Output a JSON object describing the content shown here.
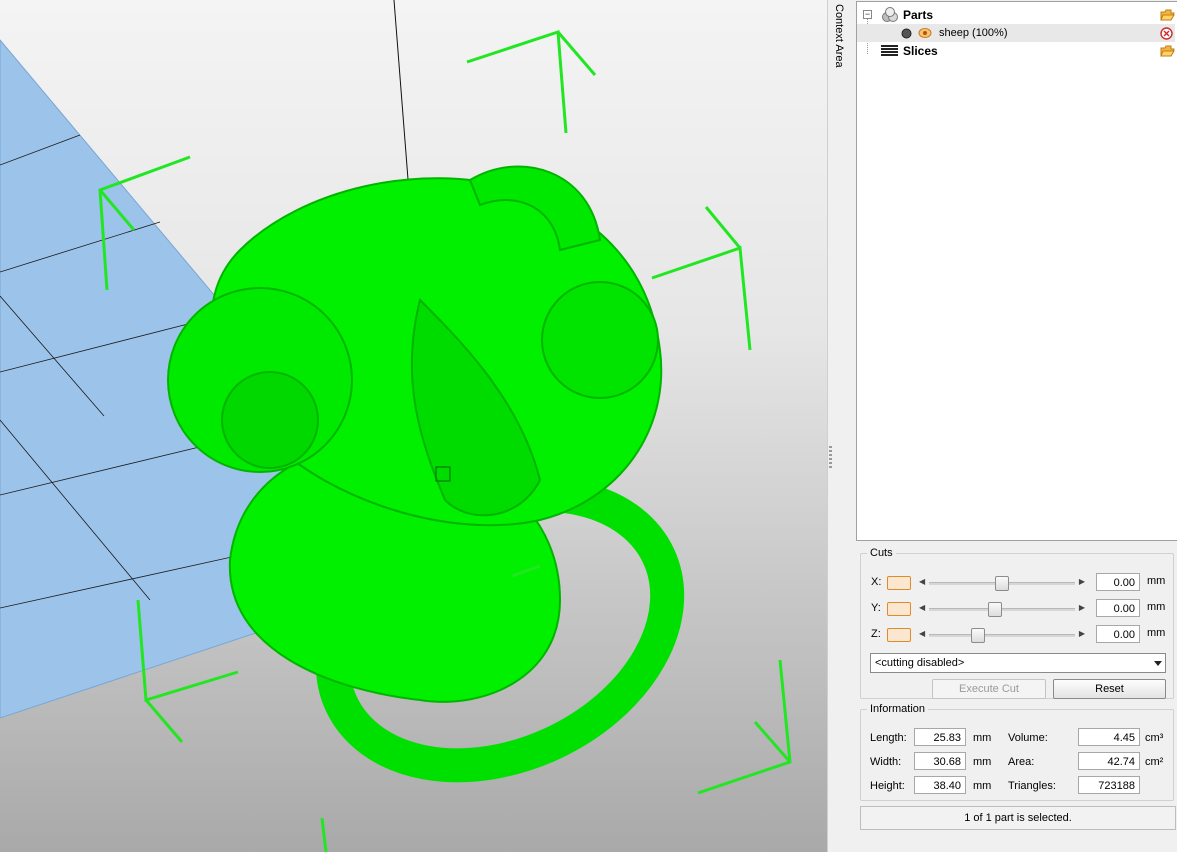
{
  "context_area": {
    "label": "Context Area"
  },
  "tree": {
    "parts": {
      "label": "Parts",
      "expander": "−"
    },
    "part_item": {
      "label": "sheep (100%)"
    },
    "slices": {
      "label": "Slices"
    }
  },
  "cuts": {
    "title": "Cuts",
    "axes": [
      {
        "label": "X:",
        "value": "0.00",
        "unit": "mm",
        "level": 0.5
      },
      {
        "label": "Y:",
        "value": "0.00",
        "unit": "mm",
        "level": 0.45
      },
      {
        "label": "Z:",
        "value": "0.00",
        "unit": "mm",
        "level": 0.32
      }
    ],
    "mode": "<cutting disabled>",
    "execute_label": "Execute Cut",
    "reset_label": "Reset"
  },
  "information": {
    "title": "Information",
    "length_label": "Length:",
    "length_value": "25.83",
    "length_unit": "mm",
    "width_label": "Width:",
    "width_value": "30.68",
    "width_unit": "mm",
    "height_label": "Height:",
    "height_value": "38.40",
    "height_unit": "mm",
    "volume_label": "Volume:",
    "volume_value": "4.45",
    "volume_unit": "cm³",
    "area_label": "Area:",
    "area_value": "42.74",
    "area_unit": "cm²",
    "triangles_label": "Triangles:",
    "triangles_value": "723188"
  },
  "status": {
    "text": "1 of 1 part is selected."
  },
  "colors": {
    "model": "#00f000",
    "bbox": "#22e622",
    "platform": "#9cc3ea",
    "accent": "#e08a2a"
  },
  "icons": {
    "parts": "parts-cubes-icon",
    "open": "folder-open-icon",
    "visible": "eye-icon",
    "remove": "remove-icon",
    "slices": "slices-icon"
  }
}
